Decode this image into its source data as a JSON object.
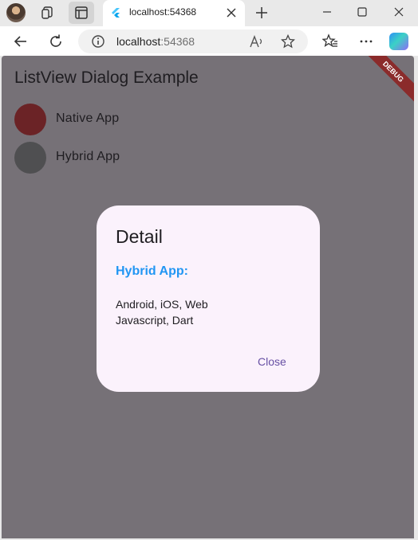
{
  "browser": {
    "tab": {
      "title": "localhost:54368"
    },
    "address": {
      "host": "localhost",
      "port": ":54368"
    }
  },
  "app": {
    "title": "ListView Dialog Example",
    "debug_label": "DEBUG",
    "items": [
      {
        "label": "Native App",
        "avatar_color": "#6b2326"
      },
      {
        "label": "Hybrid App",
        "avatar_color": "#4f4f51"
      }
    ]
  },
  "dialog": {
    "title": "Detail",
    "subtitle": "Hybrid App:",
    "lines": [
      "Android, iOS, Web",
      "Javascript, Dart"
    ],
    "close_label": "Close"
  },
  "colors": {
    "scrim": "#767177",
    "dialog_bg": "#fbf2fc",
    "accent_blue": "#2196f3",
    "button_purple": "#6750a4",
    "debug_red": "#8b2b2b"
  }
}
